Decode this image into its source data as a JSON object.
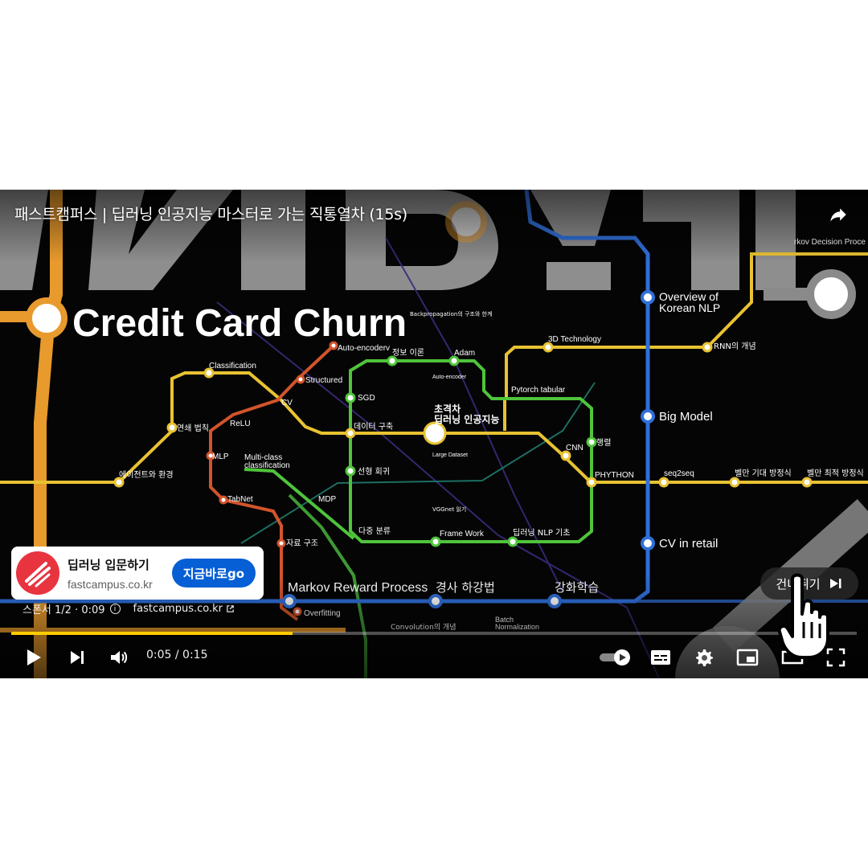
{
  "video": {
    "title": "패스트캠퍼스 | 딥러닝 인공지능 마스터로 가는 직통열차 (15s)",
    "frame": {
      "heading": "Credit Card Churn",
      "center_station": "초격차 딥러닝 인공지능",
      "stations": [
        "Auto-encoderv",
        "Structured",
        "CV",
        "Classification",
        "연쇄 법칙",
        "ReLU",
        "MLP",
        "에이전트와 환경",
        "Multi-class classification",
        "TabNet",
        "MDP",
        "자료 구조",
        "Markov Reward Process",
        "Overfitting",
        "정보 이론",
        "Adam",
        "SGD",
        "데이터 구축",
        "선형 회귀",
        "다중 분류",
        "Frame Work",
        "딥러닝 NLP 기초",
        "Pytorch tabular",
        "CNN",
        "행렬",
        "PHYTHON",
        "3D Technology",
        "RNN의 개념",
        "Overview of Korean NLP",
        "Big Model",
        "CV in retail",
        "seq2seq",
        "벨만 기대 방정식",
        "벨만 최적 방정식",
        "경사 하강법",
        "강화학습",
        "Convolution의 개념",
        "Batch Normalization",
        "Markov Decision Proce",
        "Backpropagation의 구조와 한계",
        "Auto-encoder",
        "Large Dataset",
        "VGGnet 읽기"
      ]
    }
  },
  "ad": {
    "title": "딥러닝 입문하기",
    "domain": "fastcampus.co.kr",
    "cta": "지금바로go",
    "sponsor_text": "스폰서 1/2 · 0:09",
    "sponsor_link": "fastcampus.co.kr",
    "skip_label": "건너뛰기"
  },
  "player": {
    "time": "0:05 / 0:15",
    "progress": 0.333,
    "accent_color": "#ffcc00",
    "icons": [
      "share-icon",
      "play-icon",
      "next-icon",
      "volume-icon",
      "autoplay-toggle",
      "subtitles-icon",
      "settings-icon",
      "miniplayer-icon",
      "theater-icon",
      "fullscreen-icon"
    ]
  }
}
